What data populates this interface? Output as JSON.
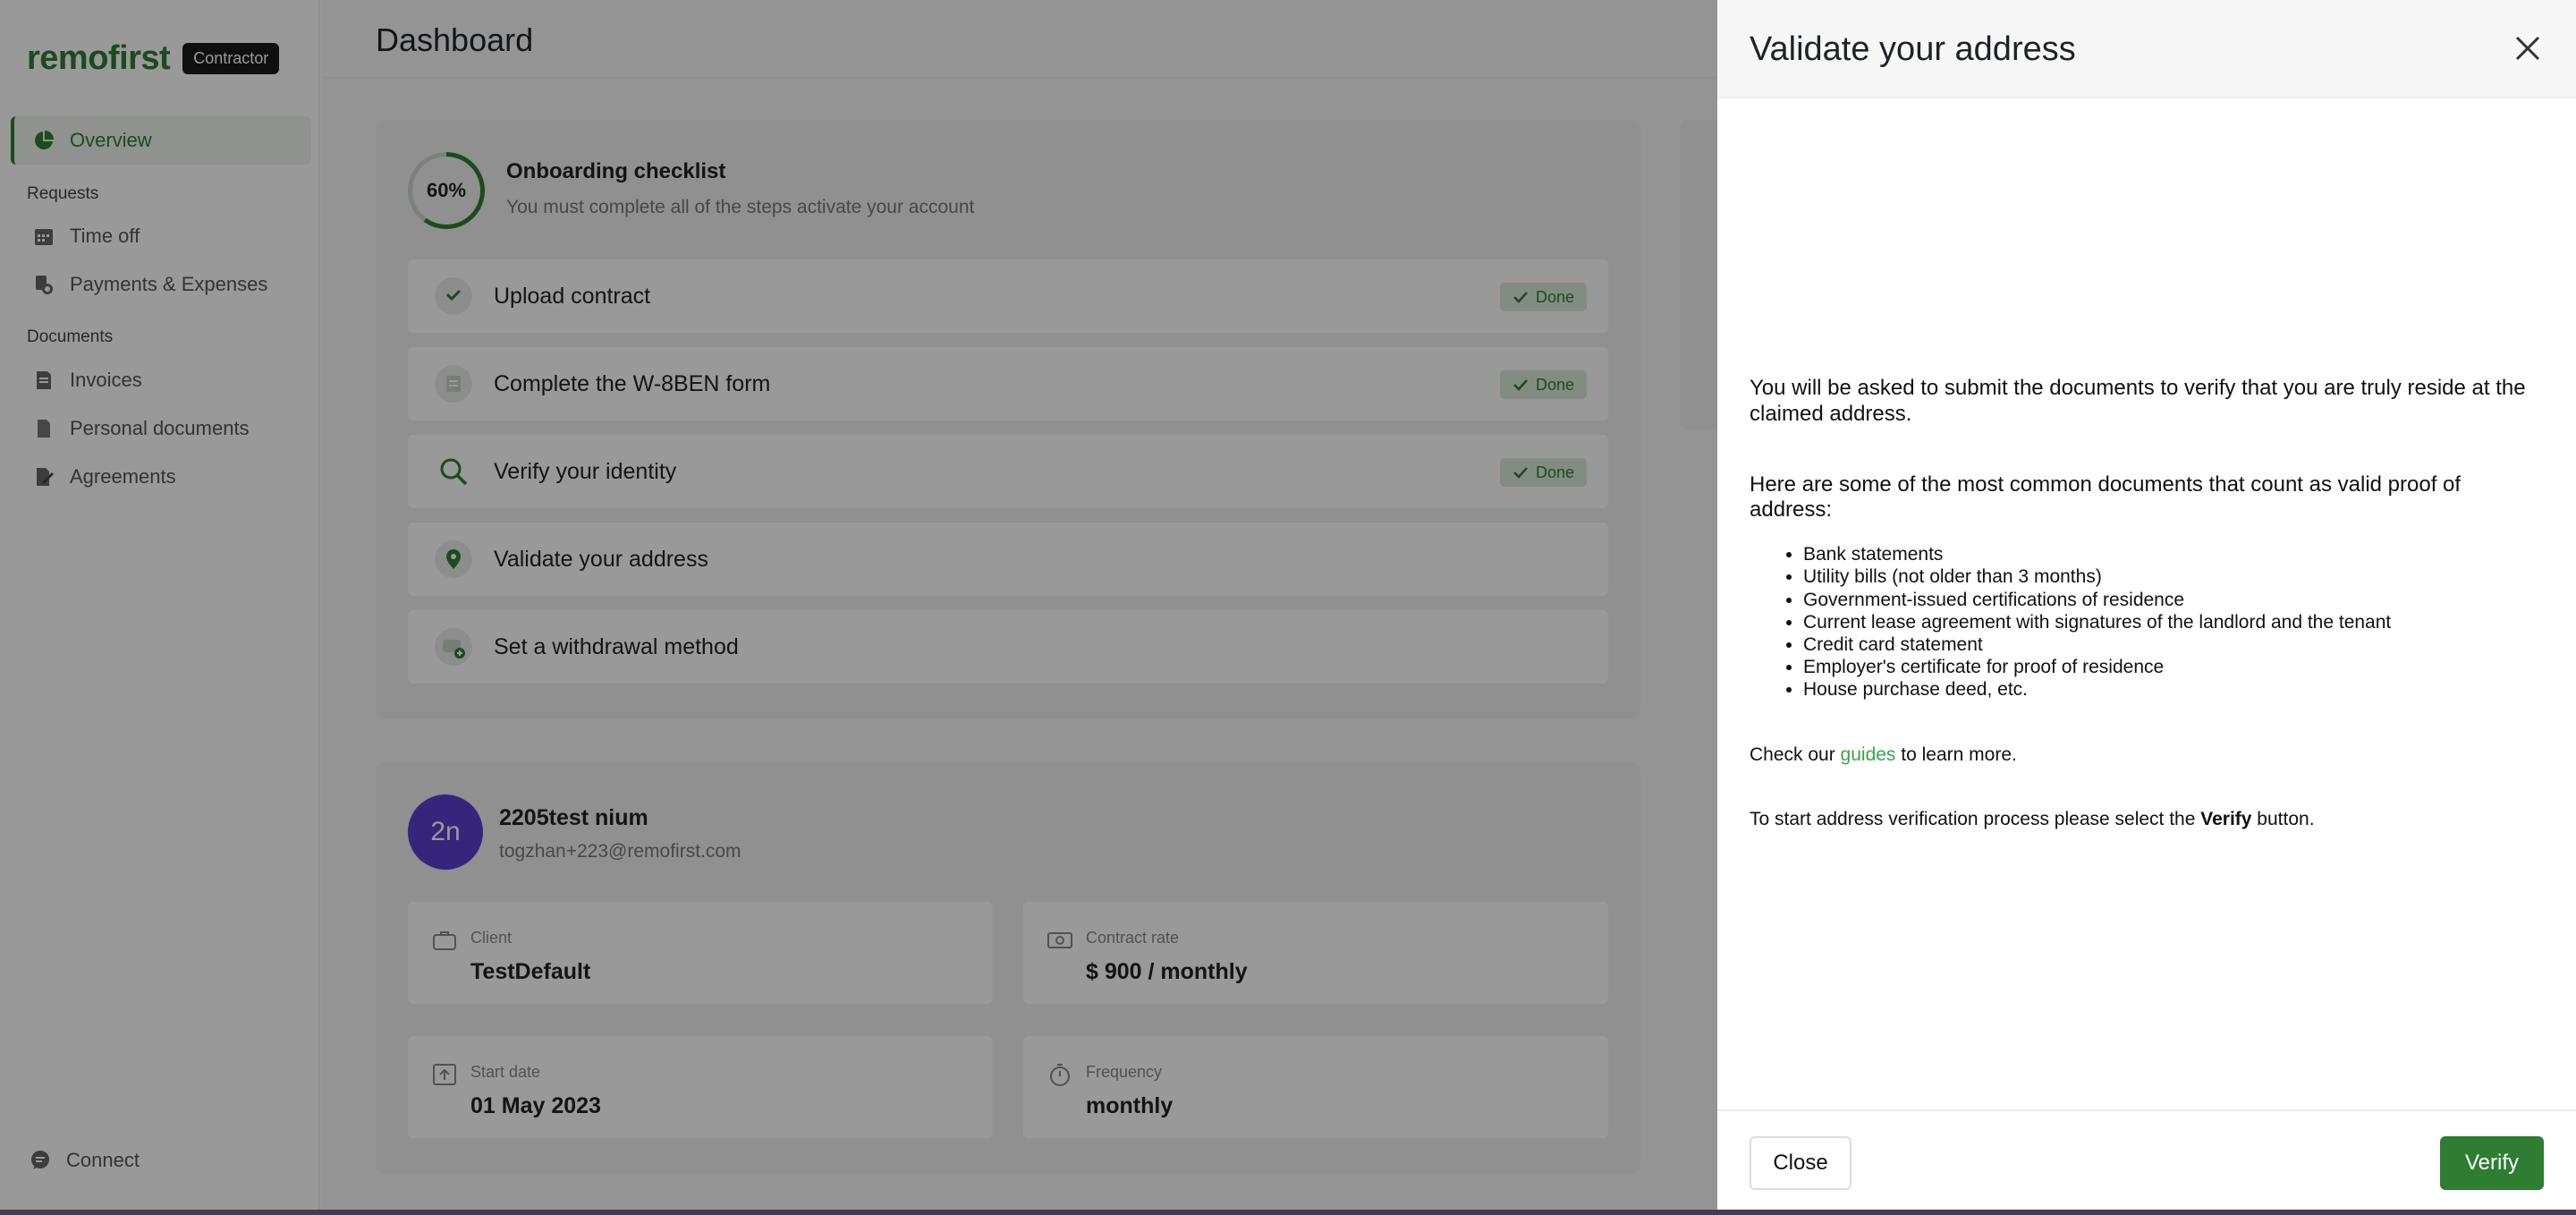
{
  "brand": {
    "name": "remofirst",
    "badge": "Contractor"
  },
  "sidebar": {
    "overview": "Overview",
    "section_requests": "Requests",
    "time_off": "Time off",
    "payments": "Payments & Expenses",
    "section_documents": "Documents",
    "invoices": "Invoices",
    "personal_documents": "Personal documents",
    "agreements": "Agreements",
    "connect": "Connect"
  },
  "header": {
    "title": "Dashboard"
  },
  "checklist": {
    "progress_label": "60%",
    "progress": 0.6,
    "title": "Onboarding checklist",
    "subtitle": "You must complete all of the steps activate your account",
    "done_label": "Done",
    "steps": [
      {
        "label": "Upload contract",
        "done": true
      },
      {
        "label": "Complete the W-8BEN form",
        "done": true
      },
      {
        "label": "Verify your identity",
        "done": true
      },
      {
        "label": "Validate your address",
        "done": false
      },
      {
        "label": "Set a withdrawal method",
        "done": false
      }
    ]
  },
  "profile": {
    "initials": "2n",
    "name": "2205test nium",
    "email": "togzhan+223@remofirst.com",
    "client_label": "Client",
    "client_value": "TestDefault",
    "rate_label": "Contract rate",
    "rate_value": "$ 900 / monthly",
    "start_label": "Start date",
    "start_value": "01 May 2023",
    "frequency_label": "Frequency",
    "frequency_value": "monthly"
  },
  "drawer": {
    "title": "Validate your address",
    "intro": "You will be asked to submit the documents to verify that you are truly reside at the claimed address.",
    "docs_heading": "Here are some of the most common documents that count as valid proof of address:",
    "documents": [
      "Bank statements",
      "Utility bills (not older than 3 months)",
      "Government-issued certifications of residence",
      "Current lease agreement with signatures of the landlord and the tenant",
      "Credit card statement",
      "Employer's certificate for proof of residence",
      "House purchase deed, etc."
    ],
    "guides_prefix": "Check our ",
    "guides_link": "guides",
    "guides_suffix": " to learn more.",
    "start_prefix": "To start address verification process please select the ",
    "start_bold": "Verify",
    "start_suffix": " button.",
    "close_label": "Close",
    "verify_label": "Verify"
  },
  "colors": {
    "accent": "#2e7d32",
    "avatar": "#5b3fd1",
    "link": "#3aa34a"
  }
}
